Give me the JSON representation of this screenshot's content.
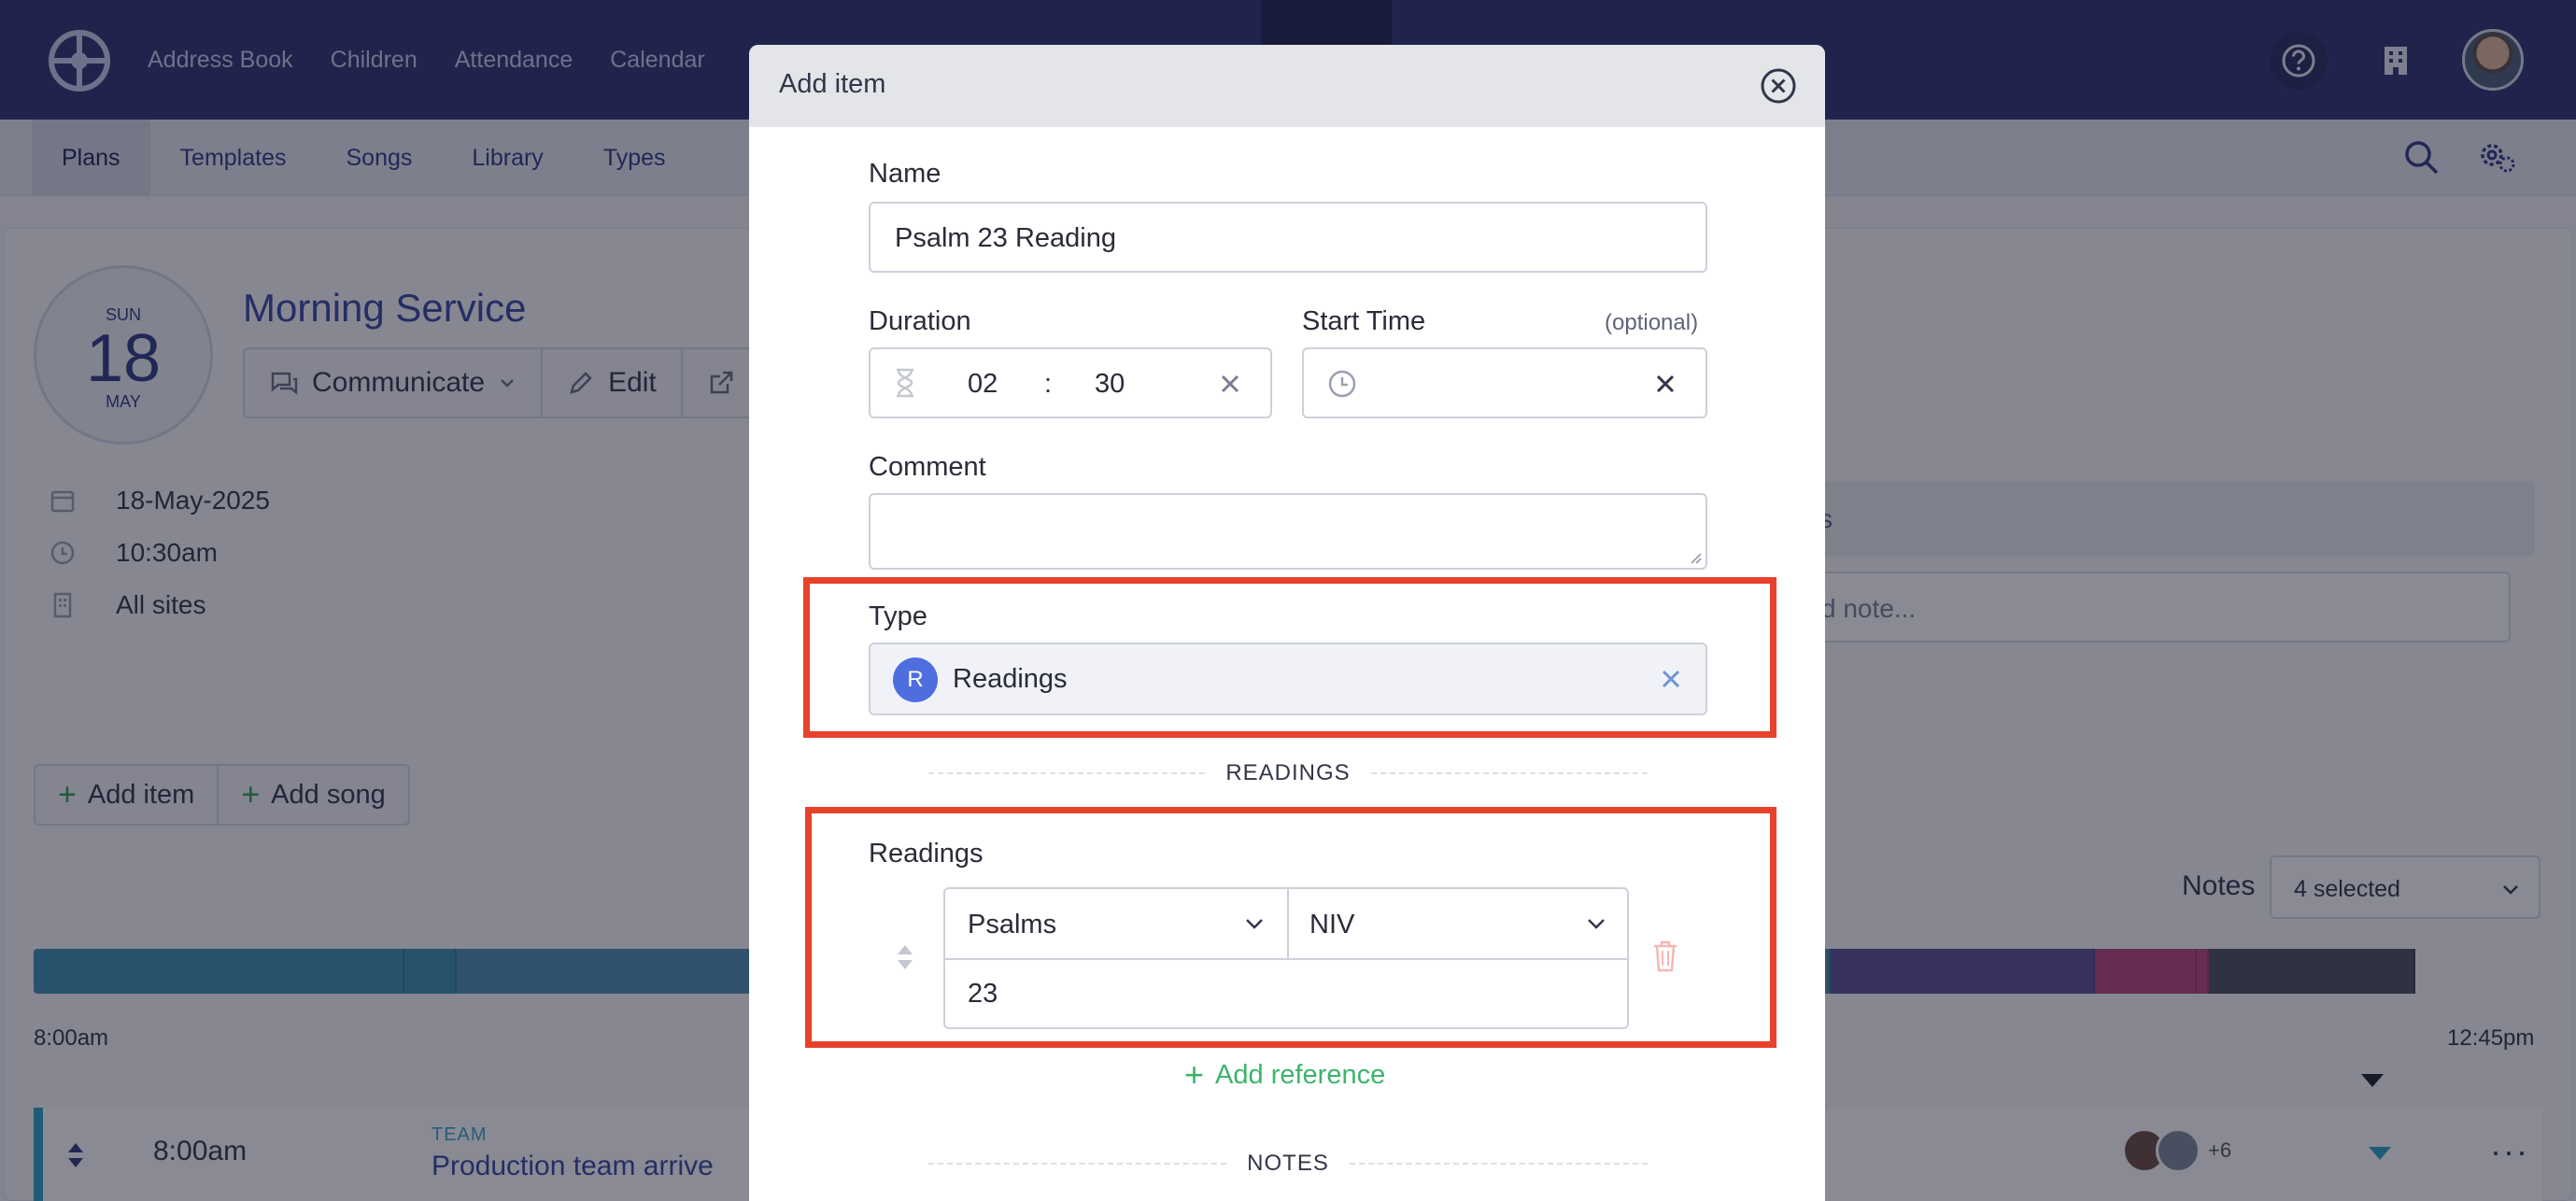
{
  "topnav": {
    "items": [
      "Address Book",
      "Children",
      "Attendance",
      "Calendar"
    ]
  },
  "subnav": {
    "items": [
      "Plans",
      "Templates",
      "Songs",
      "Library",
      "Types"
    ]
  },
  "plan": {
    "date_dow": "SUN",
    "date_day": "18",
    "date_month": "MAY",
    "title": "Morning Service",
    "actions": {
      "communicate": "Communicate",
      "edit": "Edit"
    },
    "date": "18-May-2025",
    "time": "10:30am",
    "sites": "All sites",
    "add_item": "Add item",
    "add_song": "Add song"
  },
  "notes": {
    "panel_fragment": "s",
    "input_fragment": "d note...",
    "label": "Notes",
    "selected": "4 selected"
  },
  "timeline": {
    "start": "8:00am",
    "end": "12:45pm",
    "segments": [
      {
        "color": "#3c8fb0",
        "weight": 0.148
      },
      {
        "color": "#3c8fb0",
        "weight": 0.02
      },
      {
        "color": "#5a4e96",
        "weight": 0.0
      },
      {
        "color": "#4d8fb0",
        "weight": 0.55
      },
      {
        "color": "#5a4e96",
        "weight": 0.105
      },
      {
        "color": "#b8467a",
        "weight": 0.04
      },
      {
        "color": "#b8467a",
        "weight": 0.004
      },
      {
        "color": "#4a4e5c",
        "weight": 0.082
      }
    ]
  },
  "row": {
    "time": "8:00am",
    "category": "TEAM",
    "title": "Production team arrive",
    "more_people": "+6"
  },
  "modal": {
    "title": "Add item",
    "name_label": "Name",
    "name_value": "Psalm 23 Reading",
    "duration_label": "Duration",
    "duration_min": "02",
    "duration_sep": ":",
    "duration_sec": "30",
    "start_label": "Start Time",
    "start_optional": "(optional)",
    "comment_label": "Comment",
    "type_label": "Type",
    "type_badge": "R",
    "type_value": "Readings",
    "readings_section": "READINGS",
    "readings_label": "Readings",
    "book": "Psalms",
    "version": "NIV",
    "passage": "23",
    "add_reference": "Add reference",
    "notes_section": "NOTES"
  },
  "colors": {
    "topbar": "#2c3272",
    "accent_blue": "#3646a0",
    "highlight": "#e8412c",
    "add_green": "#3bb56a",
    "type_badge": "#4e6ee0"
  }
}
